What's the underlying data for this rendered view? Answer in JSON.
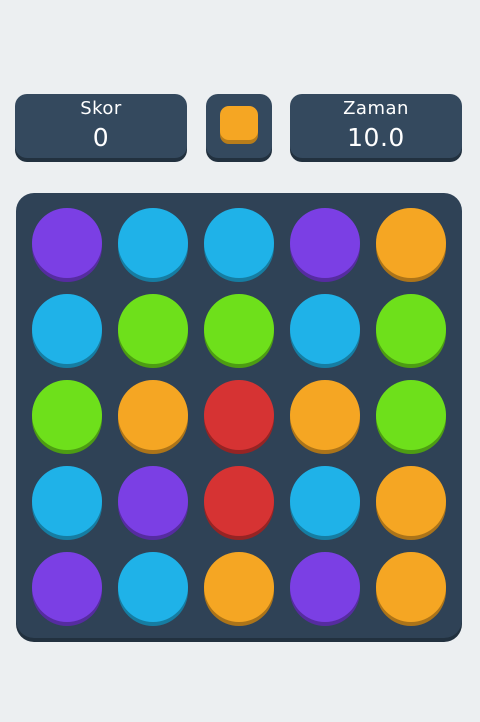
{
  "hud": {
    "score_label": "Skor",
    "score_value": "0",
    "time_label": "Zaman",
    "time_value": "10.0",
    "target_color": "#f5a623"
  },
  "palette": {
    "purple": "#7b3fe4",
    "blue": "#1fb2e8",
    "green": "#6ee01b",
    "orange": "#f5a623",
    "red": "#d63333"
  },
  "board": {
    "rows": [
      [
        "purple",
        "blue",
        "blue",
        "purple",
        "orange"
      ],
      [
        "blue",
        "green",
        "green",
        "blue",
        "green"
      ],
      [
        "green",
        "orange",
        "red",
        "orange",
        "green"
      ],
      [
        "blue",
        "purple",
        "red",
        "blue",
        "orange"
      ],
      [
        "purple",
        "blue",
        "orange",
        "purple",
        "orange"
      ]
    ]
  }
}
